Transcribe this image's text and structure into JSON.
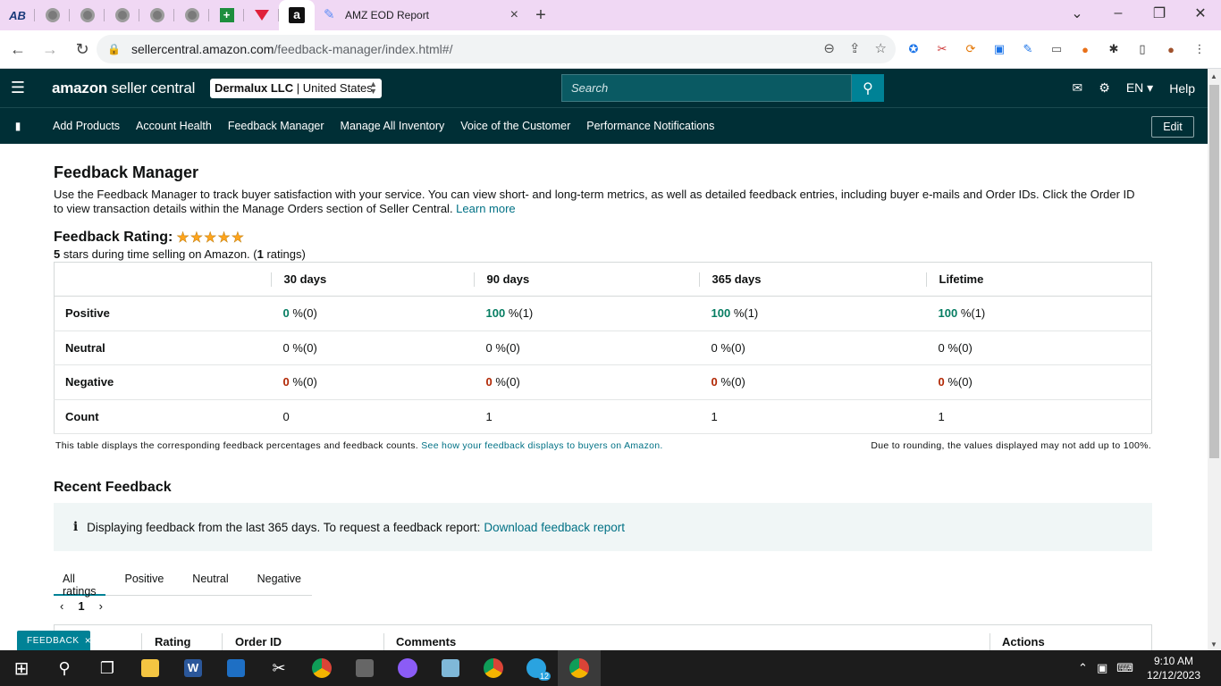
{
  "browser": {
    "active_tab_title": "AMZ EOD Report",
    "url_host": "sellercentral.amazon.com",
    "url_path": "/feedback-manager/index.html#/"
  },
  "header": {
    "logo_main": "amazon",
    "logo_sub": " seller central",
    "account_name": "Dermalux LLC",
    "account_region": " | United States",
    "search_placeholder": "Search",
    "language": "EN",
    "help": "Help"
  },
  "nav": {
    "items": [
      "Add Products",
      "Account Health",
      "Feedback Manager",
      "Manage All Inventory",
      "Voice of the Customer",
      "Performance Notifications"
    ],
    "edit_label": "Edit"
  },
  "page": {
    "title": "Feedback Manager",
    "intro": "Use the Feedback Manager to track buyer satisfaction with your service. You can view short- and long-term metrics, as well as detailed feedback entries, including buyer e-mails and Order IDs. Click the Order ID to view transaction details within the Manage Orders section of Seller Central. ",
    "learn_more": "Learn more",
    "rating_label": "Feedback Rating:",
    "rating_stars": 5,
    "rating_sub_value": "5",
    "rating_sub_text": " stars during time selling on Amazon. (",
    "rating_count": "1",
    "rating_sub_end": " ratings)"
  },
  "feedback_table": {
    "columns": [
      "30 days",
      "90 days",
      "365 days",
      "Lifetime"
    ],
    "rows": [
      {
        "label": "Positive",
        "cells": [
          {
            "v": "0",
            "rest": " %(0)"
          },
          {
            "v": "100",
            "rest": " %(1)"
          },
          {
            "v": "100",
            "rest": " %(1)"
          },
          {
            "v": "100",
            "rest": " %(1)"
          }
        ]
      },
      {
        "label": "Neutral",
        "cells": [
          {
            "v": "0",
            "rest": " %(0)"
          },
          {
            "v": "0",
            "rest": " %(0)"
          },
          {
            "v": "0",
            "rest": " %(0)"
          },
          {
            "v": "0",
            "rest": " %(0)"
          }
        ]
      },
      {
        "label": "Negative",
        "cells": [
          {
            "v": "0",
            "rest": " %(0)"
          },
          {
            "v": "0",
            "rest": " %(0)"
          },
          {
            "v": "0",
            "rest": " %(0)"
          },
          {
            "v": "0",
            "rest": " %(0)"
          }
        ]
      },
      {
        "label": "Count",
        "cells": [
          {
            "v": "0",
            "rest": ""
          },
          {
            "v": "1",
            "rest": ""
          },
          {
            "v": "1",
            "rest": ""
          },
          {
            "v": "1",
            "rest": ""
          }
        ]
      }
    ],
    "note_left": "This table displays the corresponding feedback percentages and feedback counts. ",
    "note_link": "See how your feedback displays to buyers on Amazon.",
    "note_right": "Due to rounding, the values displayed may not add up to 100%."
  },
  "recent": {
    "title": "Recent Feedback",
    "info_text": "Displaying feedback from the last 365 days. To request a feedback report: ",
    "info_link": "Download feedback report",
    "tabs": [
      "All ratings",
      "Positive",
      "Neutral",
      "Negative"
    ],
    "page": "1",
    "columns": [
      "Rating",
      "Order ID",
      "Comments",
      "Actions"
    ]
  },
  "feedback_button": "FEEDBACK",
  "taskbar": {
    "time": "9:10 AM",
    "date": "12/12/2023",
    "badge": "12"
  },
  "colors": {
    "header_bg": "#002f36",
    "accent": "#008296",
    "positive": "#067d62",
    "negative": "#b12704"
  }
}
